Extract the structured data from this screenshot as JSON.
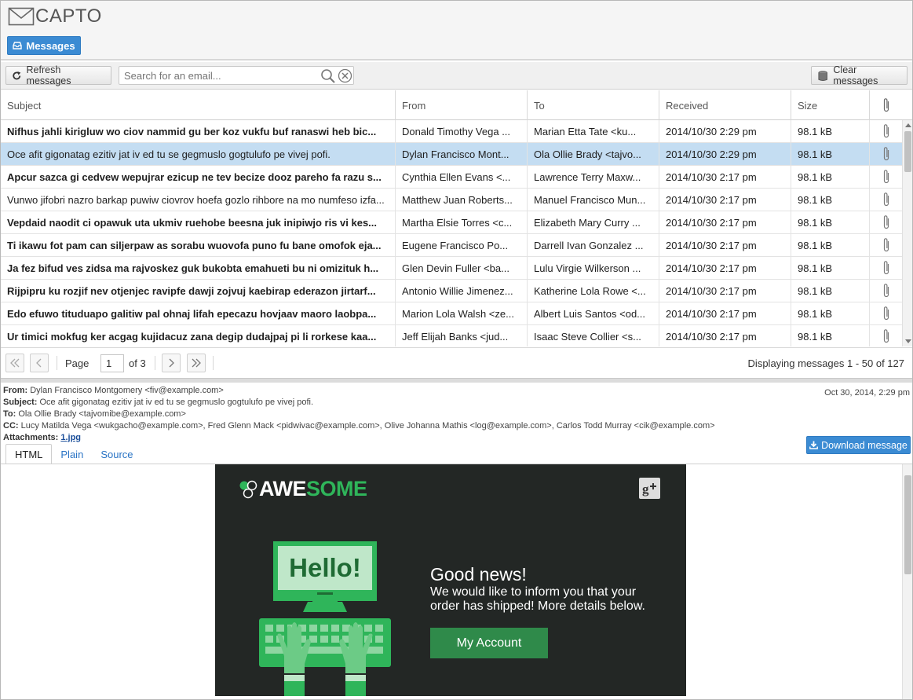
{
  "app": {
    "name": "CAPTO",
    "nav_tab": "Messages"
  },
  "toolbar": {
    "refresh_label": "Refresh messages",
    "search_placeholder": "Search for an email...",
    "clear_label": "Clear messages"
  },
  "grid": {
    "columns": [
      "Subject",
      "From",
      "To",
      "Received",
      "Size"
    ],
    "rows": [
      {
        "subject": "Nifhus jahli kirigluw wo ciov nammid gu ber koz vukfu buf ranaswi heb bic...",
        "from": "Donald Timothy Vega ...",
        "to": "Marian Etta Tate <ku...",
        "received": "2014/10/30 2:29 pm",
        "size": "98.1 kB",
        "unread": true,
        "selected": false
      },
      {
        "subject": "Oce afit gigonatag ezitiv jat iv ed tu se gegmuslo gogtulufo pe vivej pofi.",
        "from": "Dylan Francisco Mont...",
        "to": "Ola Ollie Brady <tajvo...",
        "received": "2014/10/30 2:29 pm",
        "size": "98.1 kB",
        "unread": false,
        "selected": true
      },
      {
        "subject": "Apcur sazca gi cedvew wepujrar ezicup ne tev becize dooz pareho fa razu s...",
        "from": "Cynthia Ellen Evans <...",
        "to": "Lawrence Terry Maxw...",
        "received": "2014/10/30 2:17 pm",
        "size": "98.1 kB",
        "unread": true,
        "selected": false
      },
      {
        "subject": "Vunwo jifobri nazro barkap puwiw ciovrov hoefa gozlo rihbore na mo numfeso izfa...",
        "from": "Matthew Juan Roberts...",
        "to": "Manuel Francisco Mun...",
        "received": "2014/10/30 2:17 pm",
        "size": "98.1 kB",
        "unread": false,
        "selected": false
      },
      {
        "subject": "Vepdaid naodit ci opawuk uta ukmiv ruehobe beesna juk inipiwjo ris vi kes...",
        "from": "Martha Elsie Torres <c...",
        "to": "Elizabeth Mary Curry ...",
        "received": "2014/10/30 2:17 pm",
        "size": "98.1 kB",
        "unread": true,
        "selected": false
      },
      {
        "subject": "Ti ikawu fot pam can siljerpaw as sorabu wuovofa puno fu bane omofok eja...",
        "from": "Eugene Francisco Po...",
        "to": "Darrell Ivan Gonzalez ...",
        "received": "2014/10/30 2:17 pm",
        "size": "98.1 kB",
        "unread": true,
        "selected": false
      },
      {
        "subject": "Ja fez bifud ves zidsa ma rajvoskez guk bukobta emahueti bu ni omizituk h...",
        "from": "Glen Devin Fuller <ba...",
        "to": "Lulu Virgie Wilkerson ...",
        "received": "2014/10/30 2:17 pm",
        "size": "98.1 kB",
        "unread": true,
        "selected": false
      },
      {
        "subject": "Rijpipru ku rozjif nev otjenjec ravipfe dawji zojvuj kaebirap ederazon jirtarf...",
        "from": "Antonio Willie Jimenez...",
        "to": "Katherine Lola Rowe <...",
        "received": "2014/10/30 2:17 pm",
        "size": "98.1 kB",
        "unread": true,
        "selected": false
      },
      {
        "subject": "Edo efuwo tituduapo galitiw pal ohnaj lifah epecazu hovjaav maoro laobpa...",
        "from": "Marion Lola Walsh <ze...",
        "to": "Albert Luis Santos <od...",
        "received": "2014/10/30 2:17 pm",
        "size": "98.1 kB",
        "unread": true,
        "selected": false
      },
      {
        "subject": "Ur timici mokfug ker acgag kujidacuz zana degip dudajpaj pi li rorkese kaa...",
        "from": "Jeff Elijah Banks <jud...",
        "to": "Isaac Steve Collier <s...",
        "received": "2014/10/30 2:17 pm",
        "size": "98.1 kB",
        "unread": true,
        "selected": false
      }
    ]
  },
  "pager": {
    "page_label": "Page",
    "current_page": "1",
    "of_label": "of 3",
    "display_info": "Displaying messages 1 - 50 of 127"
  },
  "detail": {
    "from_label": "From:",
    "from_value": "Dylan Francisco Montgomery <fiv@example.com>",
    "subject_label": "Subject:",
    "subject_value": "Oce afit gigonatag ezitiv jat iv ed tu se gegmuslo gogtulufo pe vivej pofi.",
    "to_label": "To:",
    "to_value": "Ola Ollie Brady <tajvomibe@example.com>",
    "cc_label": "CC:",
    "cc_value": "Lucy Matilda Vega <wukgacho@example.com>, Fred Glenn Mack <pidwivac@example.com>, Olive Johanna Mathis <log@example.com>, Carlos Todd Murray <cik@example.com>",
    "attachments_label": "Attachments:",
    "attachment_name": "1.jpg",
    "date": "Oct 30, 2014, 2:29 pm",
    "download_label": "Download message",
    "tabs": [
      "HTML",
      "Plain",
      "Source"
    ]
  },
  "email": {
    "brand_first": "AWE",
    "brand_second": "SOME",
    "hello": "Hello!",
    "news_title": "Good news!",
    "news_text": "We would like to inform you that your order has shipped! More details below.",
    "button": "My Account"
  },
  "colors": {
    "accent": "#3b8bd3",
    "selected_row": "#c4ddf2",
    "email_bg": "#232725",
    "email_green": "#2fb55a",
    "button_green": "#2f8a4a"
  }
}
